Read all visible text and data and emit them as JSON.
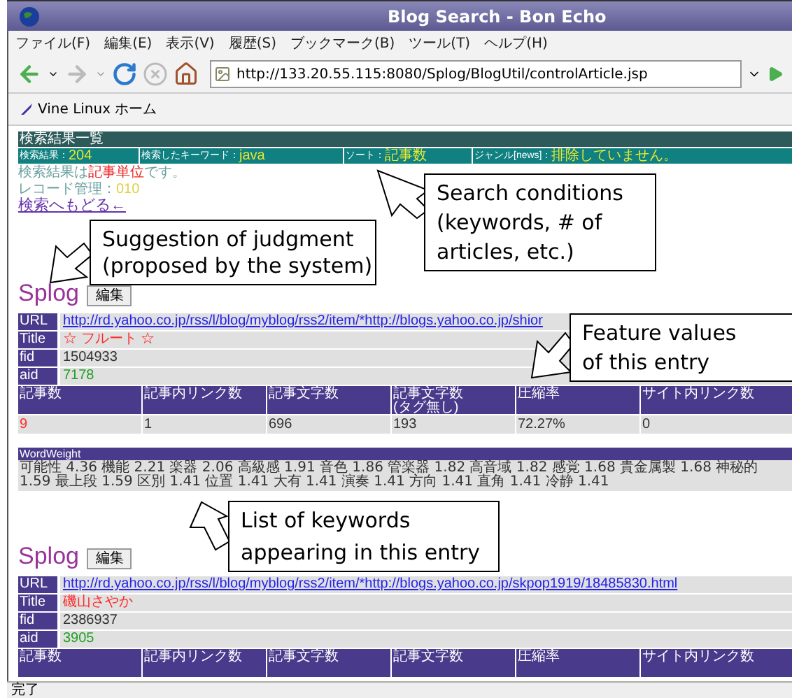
{
  "window": {
    "title": "Blog Search - Bon Echo"
  },
  "menu": [
    "ファイル(F)",
    "編集(E)",
    "表示(V)",
    "履歴(S)",
    "ブックマーク(B)",
    "ツール(T)",
    "ヘルプ(H)"
  ],
  "toolbar": {
    "url": "http://133.20.55.115:8080/Splog/BlogUtil/controlArticle.jsp"
  },
  "bookmarks": [
    "Vine Linux ホーム"
  ],
  "results": {
    "heading": "検索結果一覧",
    "conditions": [
      {
        "label": "検索結果：",
        "value": "204"
      },
      {
        "label": "検索したキーワード：",
        "value": "java"
      },
      {
        "label": "ソート：",
        "value": "記事数"
      },
      {
        "label": "ジャンル[news]：",
        "value": "排除していません。"
      }
    ],
    "unit_note": {
      "before": "検索結果は",
      "highlight": "記事単位",
      "after": "です。"
    },
    "record_note": {
      "label": "レコード管理：",
      "value": "010"
    },
    "back_link": "検索へもどる←"
  },
  "entries": [
    {
      "verdict": "Splog",
      "edit_button": "編集",
      "fields": [
        {
          "label": "URL",
          "value": "http://rd.yahoo.co.jp/rss/l/blog/myblog/rss2/item/*http://blogs.yahoo.co.jp/shior",
          "kind": "link"
        },
        {
          "label": "Title",
          "value": "☆ フルート ☆",
          "kind": "title"
        },
        {
          "label": "fid",
          "value": "1504933",
          "kind": "plain"
        },
        {
          "label": "aid",
          "value": "7178",
          "kind": "id"
        }
      ],
      "features": {
        "columns": [
          [
            "記事数"
          ],
          [
            "記事内リンク数"
          ],
          [
            "記事文字数"
          ],
          [
            "記事文字数",
            "(タグ無し)"
          ],
          [
            "圧縮率"
          ],
          [
            "サイト内リンク数"
          ]
        ],
        "values": [
          {
            "text": "9",
            "highlight": true
          },
          {
            "text": "1",
            "highlight": false
          },
          {
            "text": "696",
            "highlight": false
          },
          {
            "text": "193",
            "highlight": false
          },
          {
            "text": "72.27%",
            "highlight": false
          },
          {
            "text": "0",
            "highlight": false
          }
        ]
      },
      "word_weight": {
        "heading": "WordWeight",
        "text": "可能性 4.36 機能 2.21 楽器 2.06 高級感 1.91 音色 1.86 管楽器 1.82 高音域 1.82 感覚 1.68 貴金属製 1.68 神秘的 1.59 最上段 1.59 区別 1.41 位置 1.41 大有 1.41 演奏 1.41 方向 1.41 直角 1.41 冷静 1.41"
      }
    },
    {
      "verdict": "Splog",
      "edit_button": "編集",
      "fields": [
        {
          "label": "URL",
          "value": "http://rd.yahoo.co.jp/rss/l/blog/myblog/rss2/item/*http://blogs.yahoo.co.jp/skpop1919/18485830.html",
          "kind": "link"
        },
        {
          "label": "Title",
          "value": "磯山さやか",
          "kind": "title"
        },
        {
          "label": "fid",
          "value": "2386937",
          "kind": "plain"
        },
        {
          "label": "aid",
          "value": "3905",
          "kind": "id"
        }
      ],
      "features": {
        "columns": [
          [
            "記事数"
          ],
          [
            "記事内リンク数"
          ],
          [
            "記事文字数"
          ],
          [
            "記事文字数"
          ],
          [
            "圧縮率"
          ],
          [
            "サイト内リンク数"
          ]
        ]
      }
    }
  ],
  "callouts": [
    {
      "lines": [
        "Search conditions",
        "(keywords, # of",
        "articles, etc.)"
      ]
    },
    {
      "lines": [
        "Suggestion of judgment",
        "(proposed by the system)"
      ]
    },
    {
      "lines": [
        "Feature values",
        "of this entry"
      ]
    },
    {
      "lines": [
        "List of keywords",
        "appearing in this entry"
      ]
    }
  ],
  "status_bar": "完了"
}
